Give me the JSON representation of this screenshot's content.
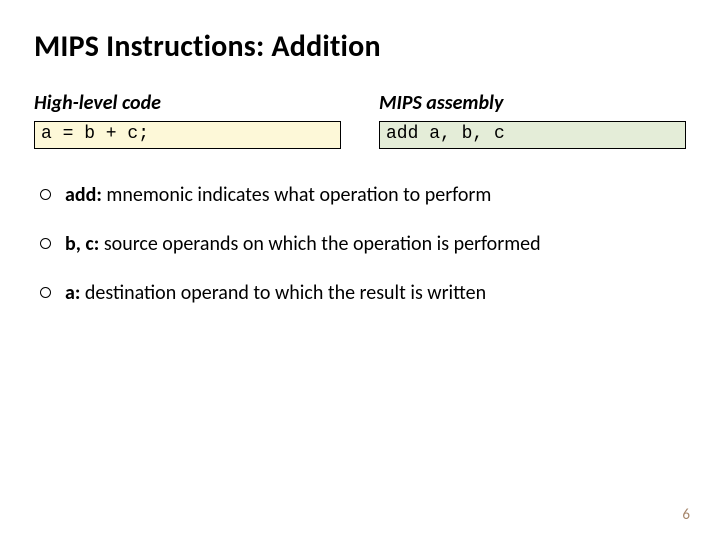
{
  "title": "MIPS Instructions: Addition",
  "left": {
    "label": "High-level code",
    "code": "a = b + c;"
  },
  "right": {
    "label": "MIPS assembly",
    "code": "add a, b, c"
  },
  "bullets": [
    {
      "lead": "add:",
      "rest": " mnemonic indicates what operation to perform"
    },
    {
      "lead": "b, c:",
      "rest": " source operands on  which the operation is performed"
    },
    {
      "lead": "a:",
      "rest": " destination operand to which the result is written"
    }
  ],
  "pageNumber": "6"
}
